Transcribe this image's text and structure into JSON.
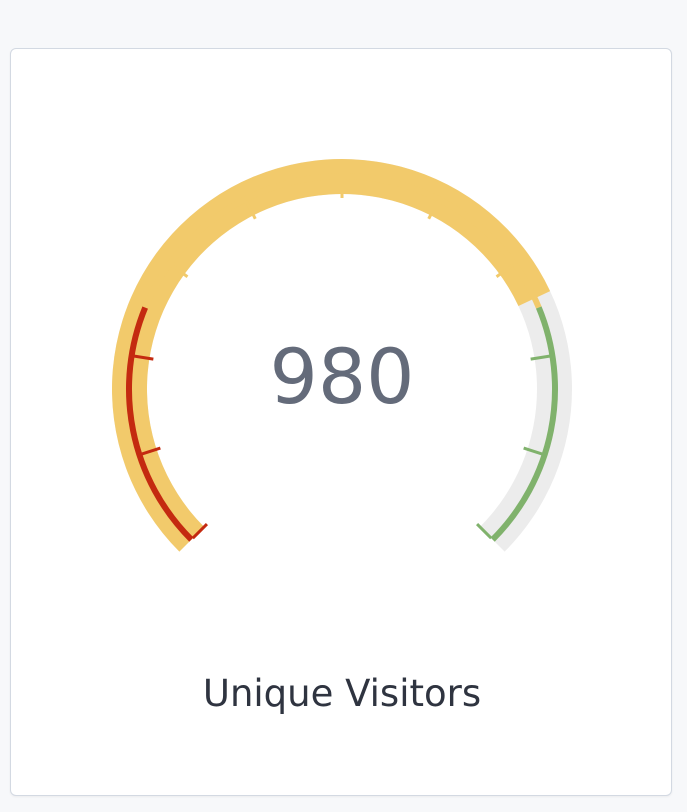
{
  "gauge": {
    "value": 980,
    "value_label": "980",
    "title": "Unique Visitors",
    "value_fraction": 0.74,
    "thresholds": [
      {
        "name": "low",
        "from": 0.0,
        "to": 0.25,
        "color": "#c42a10"
      },
      {
        "name": "mid",
        "from": 0.25,
        "to": 0.75,
        "color": "#f2ca6b"
      },
      {
        "name": "high",
        "from": 0.75,
        "to": 1.0,
        "color": "#80b26c"
      }
    ],
    "colors": {
      "value_fill": "#f2ca6b",
      "track": "#ececec",
      "value_text": "#646b7a",
      "title_text": "#2f3440"
    }
  }
}
